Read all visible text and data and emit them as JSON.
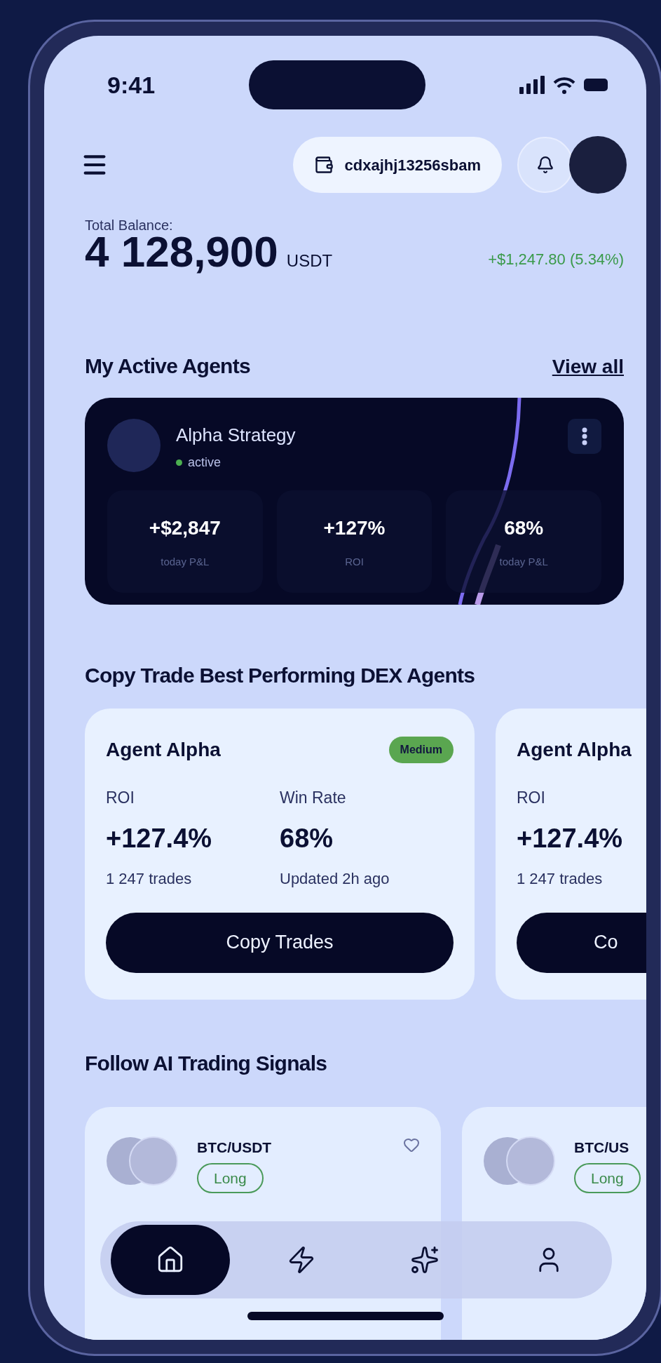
{
  "status_bar": {
    "time": "9:41"
  },
  "header": {
    "wallet_address": "cdxajhj13256sbam"
  },
  "balance": {
    "label": "Total Balance:",
    "amount": "4 128,900",
    "currency": "USDT",
    "change": "+$1,247.80 (5.34%)"
  },
  "active_agents": {
    "title": "My Active Agents",
    "link": "View all",
    "agent": {
      "name": "Alpha Strategy",
      "status": "active",
      "active": true,
      "stats": [
        {
          "value": "+$2,847",
          "label": "today P&L"
        },
        {
          "value": "+127%",
          "label": "ROI"
        },
        {
          "value": "68%",
          "label": "today P&L"
        }
      ]
    }
  },
  "copy_trade": {
    "title": "Copy Trade Best Performing DEX Agents",
    "agents": [
      {
        "name": "Agent Alpha",
        "risk": "Medium",
        "roi_label": "ROI",
        "roi": "+127.4%",
        "trades": "1 247 trades",
        "win_rate_label": "Win Rate",
        "win_rate": "68%",
        "updated": "Updated 2h ago",
        "button": "Copy Trades"
      },
      {
        "name": "Agent Alpha",
        "roi_label": "ROI",
        "roi": "+127.4%",
        "trades": "1 247 trades",
        "button": "Co"
      }
    ]
  },
  "signals": {
    "title": "Follow AI Trading Signals",
    "cards": [
      {
        "pair": "BTC/USDT",
        "direction": "Long",
        "favorite": false
      },
      {
        "pair": "BTC/US",
        "direction": "Long"
      }
    ]
  },
  "nav": [
    {
      "selected": true
    },
    {
      "selected": false
    },
    {
      "selected": false
    },
    {
      "selected": false
    }
  ]
}
